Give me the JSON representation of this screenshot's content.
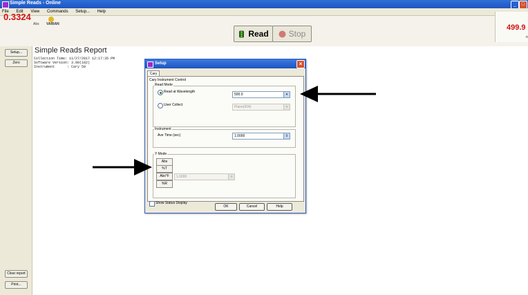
{
  "window": {
    "title": "Simple Reads - Online"
  },
  "menu": [
    "File",
    "Edit",
    "View",
    "Commands",
    "Setup...",
    "Help"
  ],
  "readout": {
    "value": "0.3324",
    "unit": "Abs",
    "logo": "VARIAN",
    "right_value": "499.9",
    "right_unit": "nm"
  },
  "toolbar": {
    "read_label": "Read",
    "stop_label": "Stop"
  },
  "left_buttons": {
    "setup": "Setup...",
    "zero": "Zero",
    "clear_report": "Clear report",
    "print": "Print..."
  },
  "report": {
    "title": "Simple Reads Report",
    "header_lines": [
      "Collection Time: 11/27/2017 12:17:35 PM",
      "Software Version: 3.00(182)",
      "Instrument      : Cary 50"
    ]
  },
  "dialog": {
    "title": "Setup",
    "tab": "Cary",
    "panel_title": "Cary Instrument Control",
    "read_mode": {
      "label": "Read Mode",
      "option_wavelength": "Read at Wavelength",
      "wavelength_value": "500.0",
      "option_user": "User Collect",
      "user_value": "Plane(004)"
    },
    "instrument": {
      "label": "Instrument",
      "ave_time_label": "Ave Time (sec)",
      "ave_time_value": "1.0000"
    },
    "ymode": {
      "label": "Y Mode",
      "buttons": [
        "Abs",
        "%T",
        "Abs*F",
        "%R"
      ],
      "factor_value": "1.0000"
    },
    "show_status": "Show Status Display",
    "ok": "OK",
    "cancel": "Cancel",
    "help": "Help"
  },
  "colors": {
    "readout": "#d01414",
    "titlebar": "#1f55c0",
    "dialog_border": "#2c5ac8"
  }
}
